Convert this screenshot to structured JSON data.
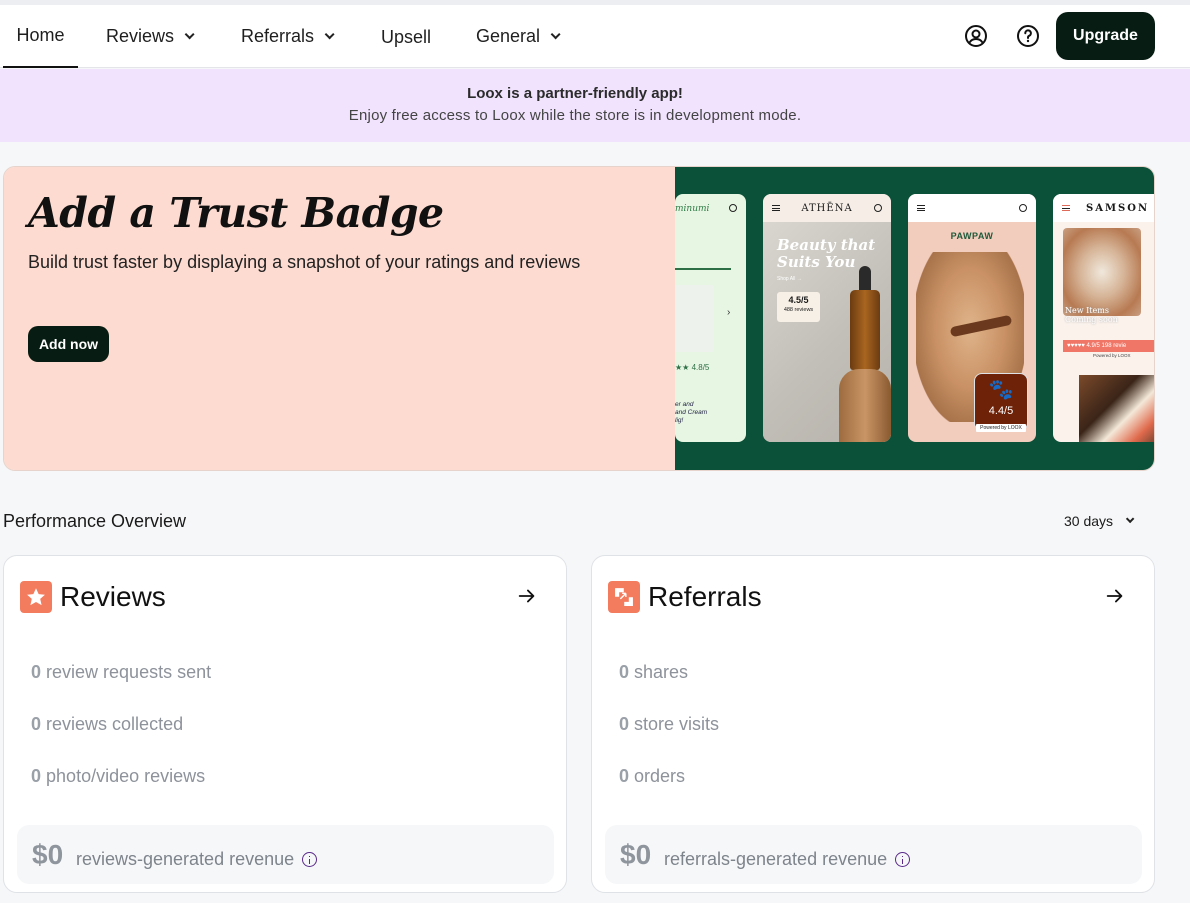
{
  "nav": {
    "items": [
      {
        "label": "Home",
        "has_dropdown": false,
        "active": true
      },
      {
        "label": "Reviews",
        "has_dropdown": true
      },
      {
        "label": "Referrals",
        "has_dropdown": true
      },
      {
        "label": "Upsell",
        "has_dropdown": false
      },
      {
        "label": "General",
        "has_dropdown": true
      }
    ],
    "account_icon": "user-circle-icon",
    "help_icon": "question-circle-icon",
    "upgrade_label": "Upgrade"
  },
  "banner": {
    "title": "Loox is a partner-friendly app!",
    "text": "Enjoy free access to Loox while the store is in development mode."
  },
  "hero": {
    "title": "Add a Trust Badge",
    "description": "Build trust faster by displaying a snapshot of your ratings and reviews",
    "button_label": "Add now",
    "colors": {
      "left_bg": "#fddbd0",
      "right_bg": "#0b5038"
    },
    "phones": [
      {
        "brand": "minumi",
        "rating": "4.8/5",
        "text": "er and\nand Cream\nlig!"
      },
      {
        "brand": "ATHĒNA",
        "headline": "Beauty that Suits You",
        "shop": "Shop All →",
        "rating": "4.5/5",
        "count": "488 reviews",
        "powered": "Powered by LOOX"
      },
      {
        "brand": "PAWPAW",
        "rating": "4.4/5",
        "powered": "Powered by LOOX"
      },
      {
        "brand": "SAMSON",
        "caption": "New Items\nComing soon",
        "rating": "4.9/5",
        "count": "198 revie",
        "powered": "Powered by LOOX"
      }
    ]
  },
  "performance": {
    "title": "Performance Overview",
    "range": "30 days"
  },
  "reviews_card": {
    "title": "Reviews",
    "icon": "star-icon",
    "stats": [
      {
        "value": "0",
        "label": "review requests sent"
      },
      {
        "value": "0",
        "label": "reviews collected"
      },
      {
        "value": "0",
        "label": "photo/video reviews"
      }
    ],
    "revenue": {
      "amount": "$0",
      "label": "reviews-generated revenue"
    }
  },
  "referrals_card": {
    "title": "Referrals",
    "icon": "referral-icon",
    "stats": [
      {
        "value": "0",
        "label": "shares"
      },
      {
        "value": "0",
        "label": "store visits"
      },
      {
        "value": "0",
        "label": "orders"
      }
    ],
    "revenue": {
      "amount": "$0",
      "label": "referrals-generated revenue"
    }
  }
}
